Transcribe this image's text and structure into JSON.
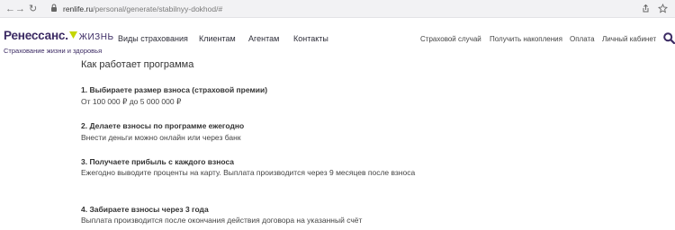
{
  "browser": {
    "back": "←",
    "forward": "→",
    "reload": "↻",
    "url_domain": "renlife.ru",
    "url_path": "/personal/generate/stabilnyy-dokhod/#"
  },
  "header": {
    "logo_name": "Ренессанс.",
    "logo_life": "ЖИЗНЬ",
    "logo_tagline": "Страхование жизни и здоровья",
    "nav_left": [
      "Виды страхования",
      "Клиентам",
      "Агентам",
      "Контакты"
    ],
    "nav_right": [
      "Страховой случай",
      "Получить накопления",
      "Оплата",
      "Личный кабинет"
    ]
  },
  "content": {
    "title": "Как работает программа",
    "steps": [
      {
        "title": "1. Выбираете размер взноса (страховой премии)",
        "text": "От 100 000 ₽ до 5 000 000 ₽"
      },
      {
        "title": "2. Делаете взносы по программе ежегодно",
        "text": "Внести деньги можно онлайн или через банк"
      },
      {
        "title": "3. Получаете прибыль с каждого взноса",
        "text": "Ежегодно выводите проценты на карту. Выплата производится через 9 месяцев после взноса"
      },
      {
        "title": "4. Забираете взносы через 3 года",
        "text": "Выплата производится после окончания действия договора на указанный счёт"
      }
    ]
  },
  "colors": {
    "brand_purple": "#3b2a63",
    "brand_accent": "#c4d600"
  },
  "icons": [
    "back-arrow-icon",
    "forward-arrow-icon",
    "reload-icon",
    "lock-icon",
    "share-icon",
    "star-icon",
    "search-icon"
  ]
}
